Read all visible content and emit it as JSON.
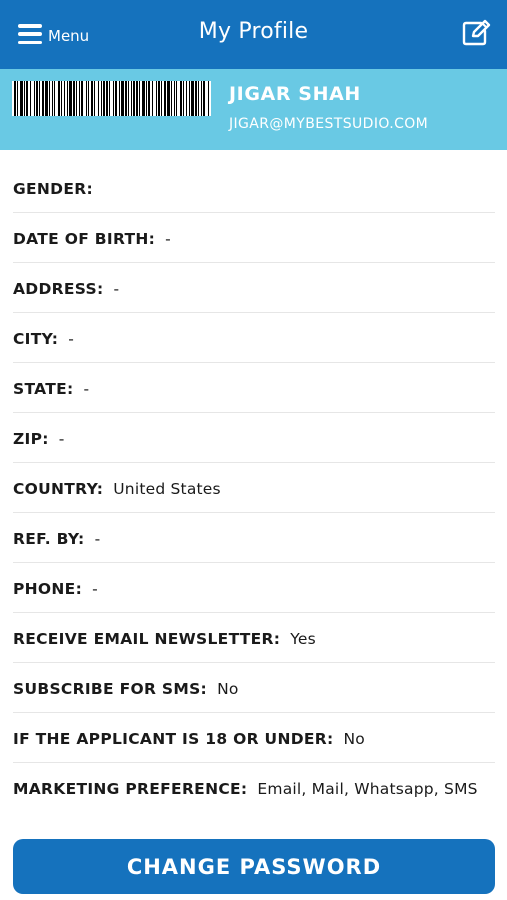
{
  "header": {
    "menu_label": "Menu",
    "title": "My Profile",
    "menu_icon": "hamburger-icon",
    "edit_icon": "edit-icon"
  },
  "profile": {
    "name": "JIGAR SHAH",
    "email": "JIGAR@MYBESTSUDIO.COM"
  },
  "fields": [
    {
      "label": "GENDER:",
      "value": ""
    },
    {
      "label": "DATE OF BIRTH:",
      "value": "-"
    },
    {
      "label": "ADDRESS:",
      "value": "-"
    },
    {
      "label": "CITY:",
      "value": "-"
    },
    {
      "label": "STATE:",
      "value": "-"
    },
    {
      "label": "ZIP:",
      "value": "-"
    },
    {
      "label": "COUNTRY:",
      "value": "United States"
    },
    {
      "label": "REF. BY:",
      "value": "-"
    },
    {
      "label": "PHONE:",
      "value": "-"
    },
    {
      "label": "RECEIVE EMAIL NEWSLETTER:",
      "value": "Yes"
    },
    {
      "label": "SUBSCRIBE FOR SMS:",
      "value": "No"
    },
    {
      "label": "IF THE APPLICANT IS 18 OR UNDER:",
      "value": "No"
    },
    {
      "label": "MARKETING PREFERENCE:",
      "value": "Email, Mail, Whatsapp, SMS"
    }
  ],
  "actions": {
    "change_password_label": "CHANGE PASSWORD"
  },
  "colors": {
    "primary": "#1572bd",
    "band": "#69c9e4",
    "text": "#1a1a1a"
  }
}
